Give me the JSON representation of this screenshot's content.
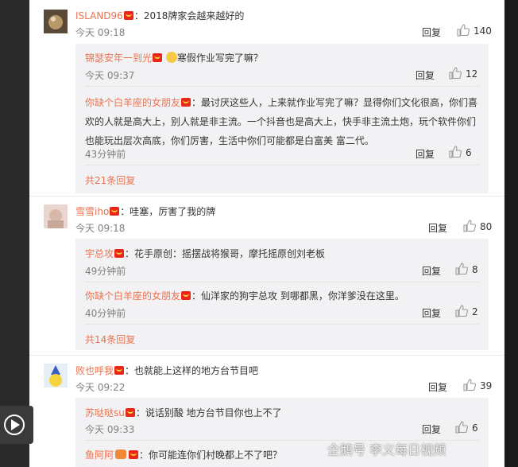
{
  "comments": [
    {
      "user": "ISLAND96",
      "text": "：2018牌家会越来越好的",
      "time": "今天 09:18",
      "reply_label": "回复",
      "likes": "140",
      "replies": [
        {
          "user": "锦瑟安年一到光",
          "text": "寒假作业写完了嘛？",
          "time": "今天 09:37",
          "reply_label": "回复",
          "likes": "12"
        },
        {
          "user": "你缺个白羊座的女朋友",
          "text": "：最讨厌这些人，上来就作业写完了嘛？显得你们文化很高，你们喜欢的人就是高大上，别人就是非主流。一个抖音也是高大上，快手非主流土炮，玩个软件你们也能玩出层次高底，你们厉害，生活中你们可能都是白富美 富二代。",
          "time": "43分钟前",
          "reply_label": "回复",
          "likes": "6"
        }
      ],
      "more_label": "共21条回复"
    },
    {
      "user": "雪雪iho",
      "text": "：哇塞，厉害了我的牌",
      "time": "今天 09:18",
      "reply_label": "回复",
      "likes": "80",
      "replies": [
        {
          "user": "宇总攻",
          "text": "：花手原创：摇摆战将猴哥，摩托摇原创刘老板",
          "time": "49分钟前",
          "reply_label": "回复",
          "likes": "8"
        },
        {
          "user": "你缺个白羊座的女朋友",
          "text": "：仙洋家的狗宇总攻  到哪都黑，你洋爹没在这里。",
          "time": "40分钟前",
          "reply_label": "回复",
          "likes": "2"
        }
      ],
      "more_label": "共14条回复"
    },
    {
      "user": "败也呼我",
      "text": "：也就能上这样的地方台节目吧",
      "time": "今天 09:22",
      "reply_label": "回复",
      "likes": "39",
      "replies": [
        {
          "user": "苏哒哒su",
          "text": "：说话别酸 地方台节目你也上不了",
          "time": "今天 09:33",
          "reply_label": "回复",
          "likes": "6"
        },
        {
          "user": "鱼阿阿",
          "text": "：你可能连你们村晚都上不了吧？",
          "time": "",
          "reply_label": "",
          "likes": ""
        }
      ]
    }
  ],
  "watermark": "企鹅号 李义每日视频"
}
